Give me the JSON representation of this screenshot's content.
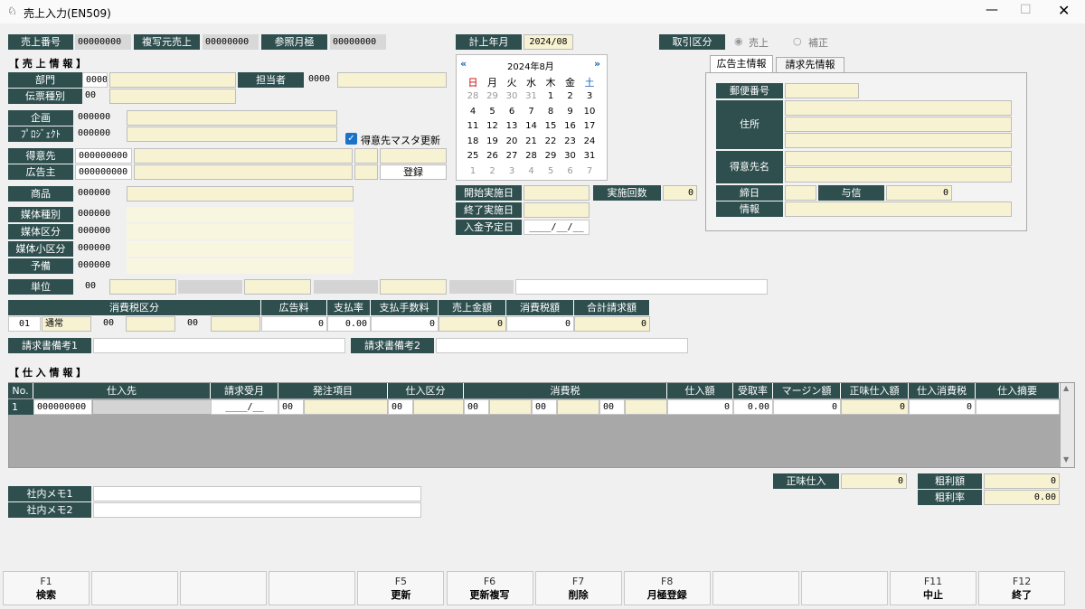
{
  "window": {
    "title": "売上入力(EN509)"
  },
  "header": {
    "sales_no_label": "売上番号",
    "sales_no": "00000000",
    "copy_src_label": "複写元売上",
    "copy_src": "00000000",
    "ref_month_label": "参照月極",
    "ref_month": "00000000",
    "acct_month_label": "計上年月",
    "acct_month": "2024/08",
    "trade_type_label": "取引区分",
    "trade_options": [
      "売上",
      "補正"
    ]
  },
  "sales_info": {
    "section": "【 売 上 情 報 】",
    "dept_label": "部門",
    "dept": "0000",
    "person_label": "担当者",
    "person": "0000",
    "slip_type_label": "伝票種別",
    "slip_type": "00",
    "plan_label": "企画",
    "plan": "000000",
    "project_label": "ﾌﾟﾛｼﾞｪｸﾄ",
    "project": "000000",
    "master_update": "得意先マスタ更新",
    "customer_label": "得意先",
    "customer": "000000000",
    "advertiser_label": "広告主",
    "advertiser": "000000000",
    "register_button": "登録",
    "product_label": "商品",
    "product": "000000",
    "media_type_label": "媒体種別",
    "media_type": "000000",
    "media_cat_label": "媒体区分",
    "media_cat": "000000",
    "media_subcat_label": "媒体小区分",
    "media_subcat": "000000",
    "reserve_label": "予備",
    "reserve": "000000",
    "unit_label": "単位",
    "unit": "00"
  },
  "calendar": {
    "month": "2024年8月",
    "prev": "«",
    "next": "»",
    "weekdays": [
      "日",
      "月",
      "火",
      "水",
      "木",
      "金",
      "土"
    ],
    "weeks": [
      [
        "28",
        "29",
        "30",
        "31",
        "1",
        "2",
        "3"
      ],
      [
        "4",
        "5",
        "6",
        "7",
        "8",
        "9",
        "10"
      ],
      [
        "11",
        "12",
        "13",
        "14",
        "15",
        "16",
        "17"
      ],
      [
        "18",
        "19",
        "20",
        "21",
        "22",
        "23",
        "24"
      ],
      [
        "25",
        "26",
        "27",
        "28",
        "29",
        "30",
        "31"
      ],
      [
        "1",
        "2",
        "3",
        "4",
        "5",
        "6",
        "7"
      ]
    ]
  },
  "dates": {
    "start_label": "開始実施日",
    "end_label": "終了実施日",
    "count_label": "実施回数",
    "count": "0",
    "payment_label": "入金予定日",
    "payment": "____/__/__"
  },
  "tabs": [
    "広告主情報",
    "請求先情報"
  ],
  "advertiser_panel": {
    "postal_label": "郵便番号",
    "address_label": "住所",
    "customer_name_label": "得意先名",
    "closing_label": "締日",
    "credit_label": "与信",
    "credit": "0",
    "info_label": "情報"
  },
  "tax_table": {
    "headers": [
      "消費税区分",
      "広告料",
      "支払率",
      "支払手数料",
      "売上金額",
      "消費税額",
      "合計請求額"
    ],
    "row": {
      "code": "01",
      "name": "通常",
      "c2": "00",
      "c3": "00",
      "ad_fee": "0",
      "pay_rate": "0.00",
      "fee": "0",
      "sales": "0",
      "tax": "0",
      "total": "0"
    },
    "memo1_label": "請求書備考1",
    "memo2_label": "請求書備考2"
  },
  "purchase": {
    "section": "【 仕 入 情 報 】",
    "headers": [
      "No.",
      "仕入先",
      "請求受月",
      "発注項目",
      "仕入区分",
      "消費税",
      "仕入額",
      "受取率",
      "マージン額",
      "正味仕入額",
      "仕入消費税",
      "仕入摘要"
    ],
    "row": {
      "no": "1",
      "supplier": "000000000",
      "month": "____/__",
      "order": "00",
      "kubun": "00",
      "t1": "00",
      "t2": "00",
      "t3": "00",
      "amount": "0",
      "rate": "0.00",
      "margin": "0",
      "net": "0",
      "tax": "0"
    },
    "net_label": "正味仕入",
    "net_total": "0",
    "gross_label": "粗利額",
    "gross": "0",
    "gross_rate_label": "粗利率",
    "gross_rate": "0.00",
    "memo1_label": "社内メモ1",
    "memo2_label": "社内メモ2"
  },
  "fkeys": [
    {
      "key": "F1",
      "label": "検索"
    },
    {
      "key": "",
      "label": ""
    },
    {
      "key": "",
      "label": ""
    },
    {
      "key": "",
      "label": ""
    },
    {
      "key": "F5",
      "label": "更新"
    },
    {
      "key": "F6",
      "label": "更新複写"
    },
    {
      "key": "F7",
      "label": "削除"
    },
    {
      "key": "F8",
      "label": "月極登録"
    },
    {
      "key": "",
      "label": ""
    },
    {
      "key": "",
      "label": ""
    },
    {
      "key": "F11",
      "label": "中止"
    },
    {
      "key": "F12",
      "label": "終了"
    }
  ]
}
